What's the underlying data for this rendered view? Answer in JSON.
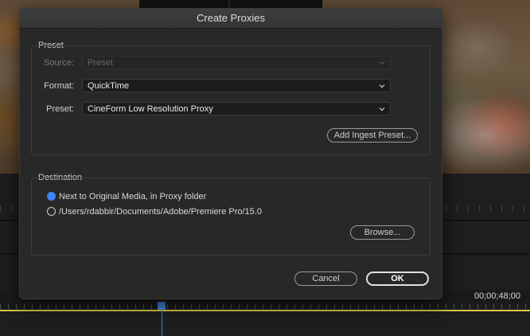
{
  "background": {
    "timecode": "00;00;48;00"
  },
  "dialog": {
    "title": "Create Proxies",
    "preset_group": {
      "title": "Preset",
      "source_label": "Source:",
      "source_value": "Preset",
      "format_label": "Format:",
      "format_value": "QuickTime",
      "preset_label": "Preset:",
      "preset_value": "CineForm Low Resolution Proxy",
      "add_ingest_label": "Add Ingest Preset..."
    },
    "destination_group": {
      "title": "Destination",
      "options": [
        {
          "label": "Next to Original Media, in Proxy folder",
          "selected": true
        },
        {
          "label": "/Users/rdabbir/Documents/Adobe/Premiere Pro/15.0",
          "selected": false
        }
      ],
      "browse_label": "Browse..."
    },
    "cancel_label": "Cancel",
    "ok_label": "OK"
  },
  "colors": {
    "accent": "#3a86f4",
    "workarea": "#d8c84a",
    "playhead": "#3f86d8"
  }
}
